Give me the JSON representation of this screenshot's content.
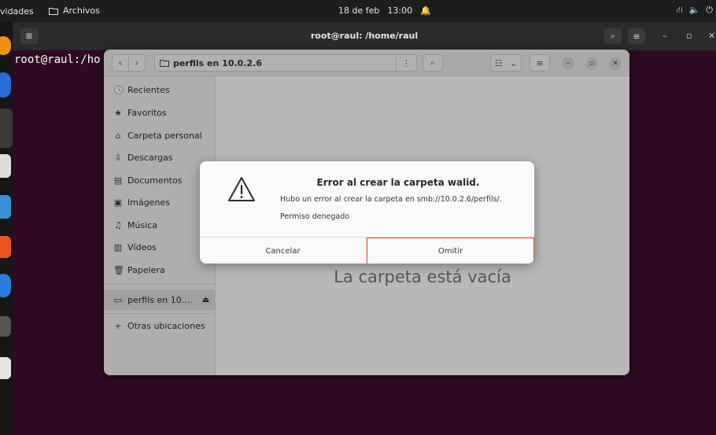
{
  "topbar": {
    "activities": "vidades",
    "files_app": "Archivos",
    "date": "18 de feb",
    "time": "13:00",
    "tray": [
      "⛙",
      "🔈",
      "⏻"
    ]
  },
  "terminal": {
    "title": "root@raul: /home/raul",
    "prompt": "root@raul:/ho"
  },
  "files": {
    "path_label": "perfils en 10.0.2.6",
    "sidebar": [
      {
        "icon": "🕓",
        "label": "Recientes"
      },
      {
        "icon": "★",
        "label": "Favoritos"
      },
      {
        "icon": "⌂",
        "label": "Carpeta personal"
      },
      {
        "icon": "⇩",
        "label": "Descargas"
      },
      {
        "icon": "▤",
        "label": "Documentos"
      },
      {
        "icon": "▣",
        "label": "Imágenes"
      },
      {
        "icon": "♫",
        "label": "Música"
      },
      {
        "icon": "▥",
        "label": "Vídeos"
      },
      {
        "icon": "🗑",
        "label": "Papelera"
      }
    ],
    "network_item": {
      "label": "perfils en 10....",
      "eject": "⏏"
    },
    "other_locations": {
      "icon": "+",
      "label": "Otras ubicaciones"
    },
    "empty_message": "La carpeta está vacía"
  },
  "dialog": {
    "title": "Error al crear la carpeta walid.",
    "message": "Hubo un error al crear la carpeta en smb://10.0.2.6/perfils/.",
    "detail": "Permiso denegado",
    "cancel_label": "Cancelar",
    "omit_label": "Omitir"
  },
  "colors": {
    "terminal_bg": "#300a24",
    "accent": "#e95420"
  }
}
